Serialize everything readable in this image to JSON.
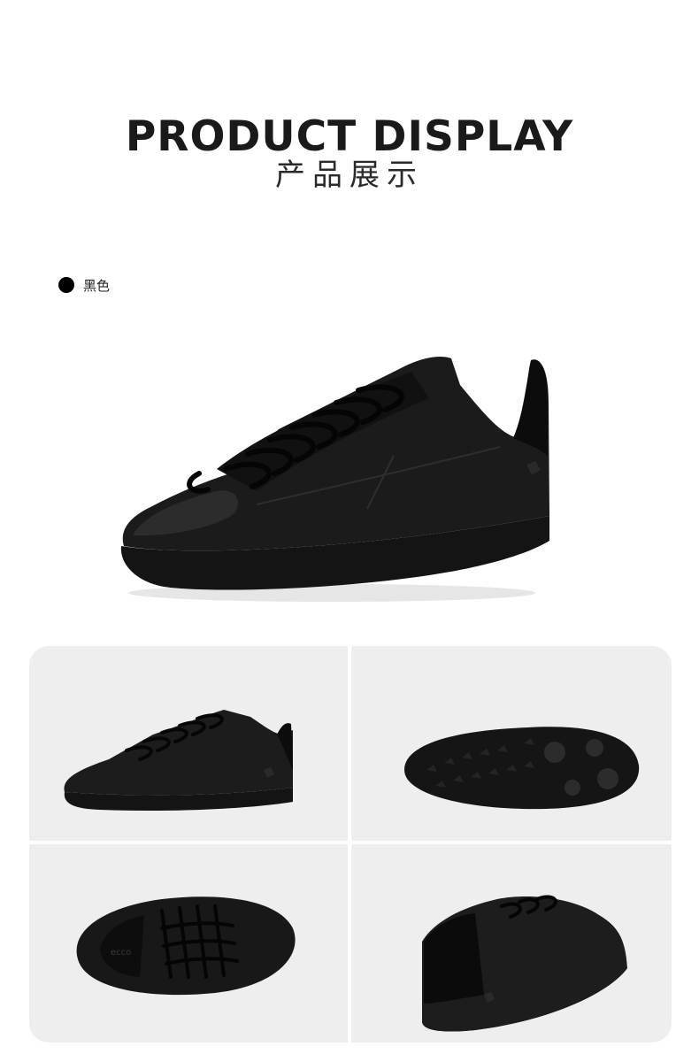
{
  "header": {
    "title": "PRODUCT DISPLAY",
    "subtitle": "产品展示"
  },
  "color_option": {
    "label": "黑色",
    "swatch": "#000000"
  },
  "hero_image": {
    "icon": "black-leather-sneaker-side-view"
  },
  "gallery": {
    "views": [
      "sneaker-side-view",
      "sneaker-sole-view",
      "sneaker-top-view",
      "sneaker-rear-view"
    ]
  },
  "brand_mark": "ecco"
}
